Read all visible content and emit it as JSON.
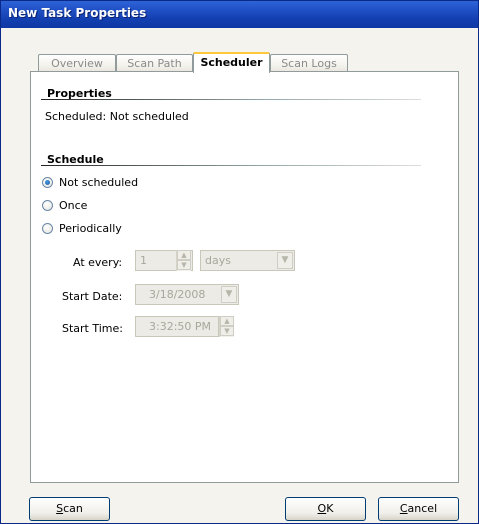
{
  "window": {
    "title": "New Task Properties"
  },
  "tabs": [
    {
      "label": "Overview",
      "active": false
    },
    {
      "label": "Scan Path",
      "active": false
    },
    {
      "label": "Scheduler",
      "active": true
    },
    {
      "label": "Scan Logs",
      "active": false
    }
  ],
  "properties": {
    "title": "Properties",
    "scheduled_text": "Scheduled: Not scheduled"
  },
  "schedule": {
    "title": "Schedule",
    "options": [
      {
        "label": "Not scheduled",
        "selected": true
      },
      {
        "label": "Once",
        "selected": false
      },
      {
        "label": "Periodically",
        "selected": false
      }
    ],
    "at_every": {
      "label": "At every:",
      "value": "1",
      "unit": "days"
    },
    "start_date": {
      "label": "Start Date:",
      "value": "3/18/2008"
    },
    "start_time": {
      "label": "Start Time:",
      "value": "3:32:50 PM"
    }
  },
  "buttons": {
    "scan": {
      "mnemonic": "S",
      "rest": "can"
    },
    "ok": {
      "mnemonic": "O",
      "rest": "K"
    },
    "cancel": {
      "mnemonic": "C",
      "rest": "ancel"
    }
  },
  "colors": {
    "titlebar": "#1f4fc4",
    "active_tab_accent": "#ffc83c"
  }
}
